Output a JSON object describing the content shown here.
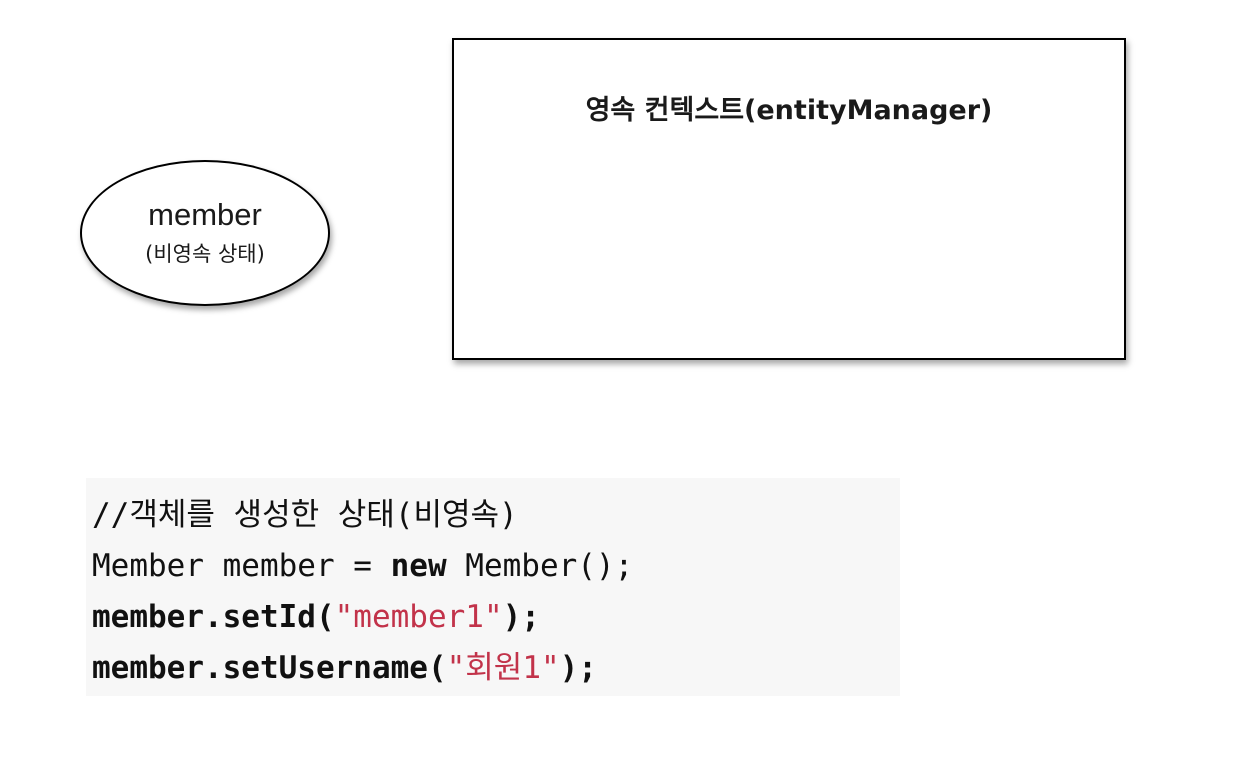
{
  "entity": {
    "name": "member",
    "state": "(비영속 상태)"
  },
  "persistence_context": {
    "title": "영속 컨텍스트(entityManager)"
  },
  "code": {
    "comment": "//객체를 생성한 상태(비영속)",
    "line2_a": "Member member = ",
    "line2_kw": "new",
    "line2_b": " Member();",
    "line3_a": "member.setId(",
    "line3_str": "\"member1\"",
    "line3_b": ");",
    "line4_a": "member.setUsername(",
    "line4_str": "\"회원1\"",
    "line4_b": ");"
  },
  "colors": {
    "string_literal": "#c2334a",
    "code_background": "#f7f7f7"
  }
}
